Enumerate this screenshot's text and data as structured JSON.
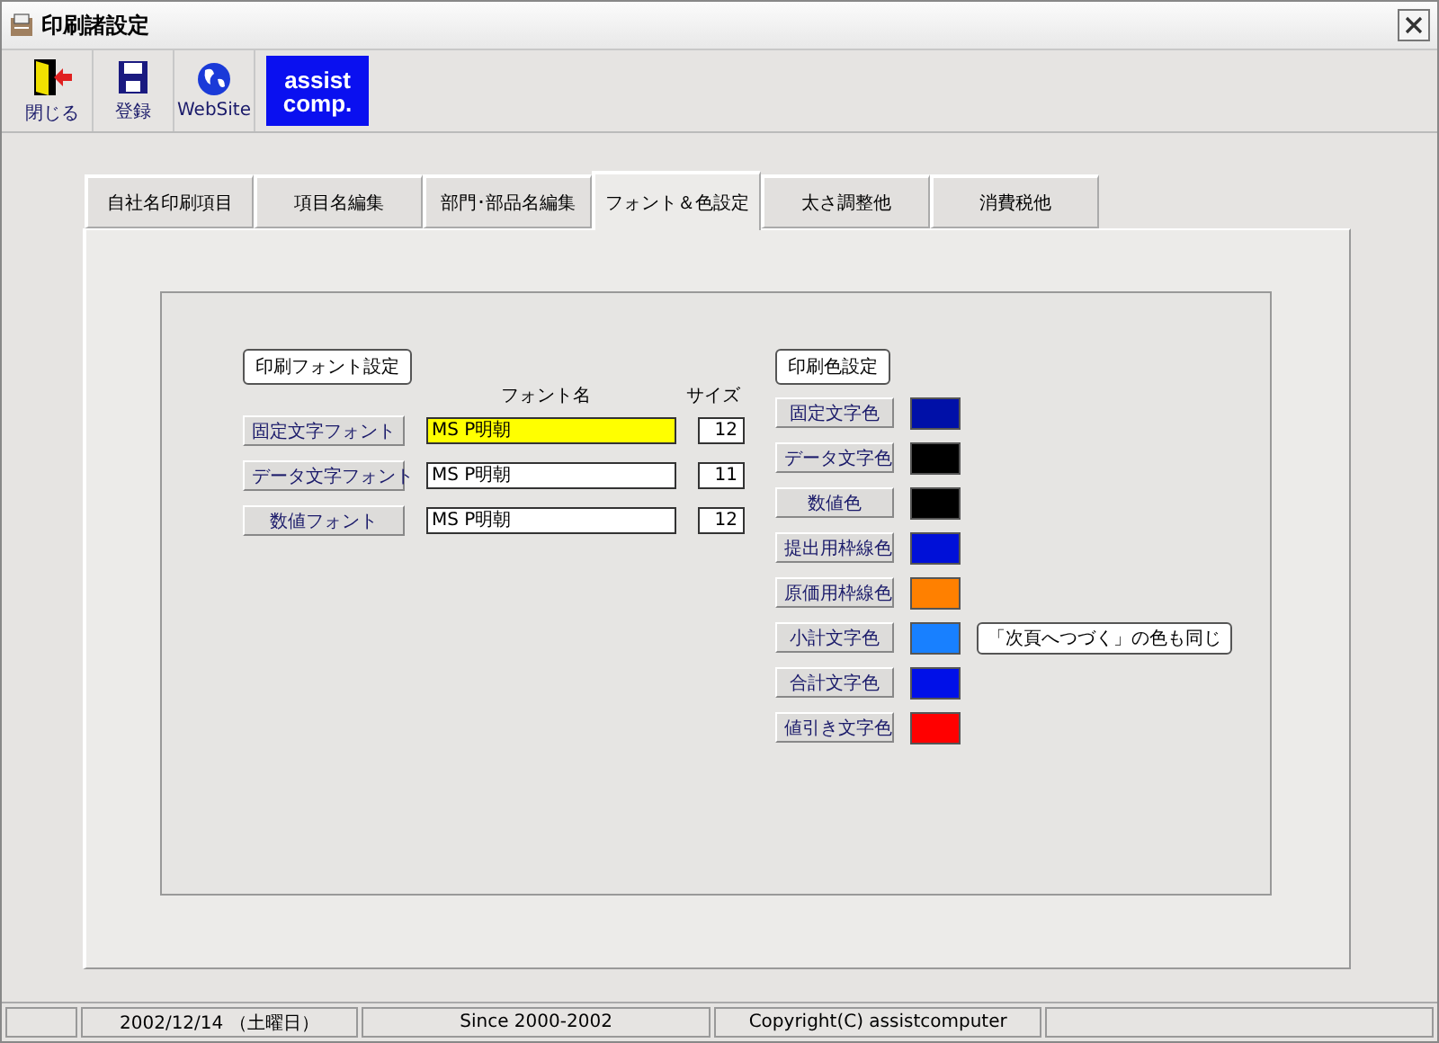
{
  "window": {
    "title": "印刷諸設定"
  },
  "toolbar": [
    {
      "kind": "exit",
      "label": "閉じる"
    },
    {
      "kind": "save",
      "label": "登録"
    },
    {
      "kind": "web",
      "label": "WebSite"
    },
    {
      "kind": "logo",
      "lines": [
        "assist",
        "comp."
      ]
    }
  ],
  "tabs": [
    {
      "label": "自社名印刷項目",
      "selected": false
    },
    {
      "label": "項目名編集",
      "selected": false
    },
    {
      "label": "部門･部品名編集",
      "selected": false
    },
    {
      "label": "フォント＆色設定",
      "selected": true
    },
    {
      "label": "太さ調整他",
      "selected": false
    },
    {
      "label": "消費税他",
      "selected": false
    }
  ],
  "font_section": {
    "heading": "印刷フォント設定",
    "name_header": "フォント名",
    "size_header": "サイズ",
    "rows": [
      {
        "button": "固定文字フォント",
        "font": "MS P明朝",
        "size": "12",
        "focused": true
      },
      {
        "button": "データ文字フォント",
        "font": "MS P明朝",
        "size": "11",
        "focused": false
      },
      {
        "button": "数値フォント",
        "font": "MS P明朝",
        "size": "12",
        "focused": false
      }
    ]
  },
  "color_section": {
    "heading": "印刷色設定",
    "rows": [
      {
        "button": "固定文字色",
        "color": "#0010a8"
      },
      {
        "button": "データ文字色",
        "color": "#000000"
      },
      {
        "button": "数値色",
        "color": "#000000"
      },
      {
        "button": "提出用枠線色",
        "color": "#0010d8"
      },
      {
        "button": "原価用枠線色",
        "color": "#ff8000"
      },
      {
        "button": "小計文字色",
        "color": "#1880ff",
        "note": "「次頁へつづく」の色も同じ"
      },
      {
        "button": "合計文字色",
        "color": "#0010e8"
      },
      {
        "button": "値引き文字色",
        "color": "#ff0000"
      }
    ]
  },
  "status_bar": [
    "2002/12/14 （土曜日）",
    "Since 2000-2002",
    "Copyright(C) assistcomputer"
  ]
}
